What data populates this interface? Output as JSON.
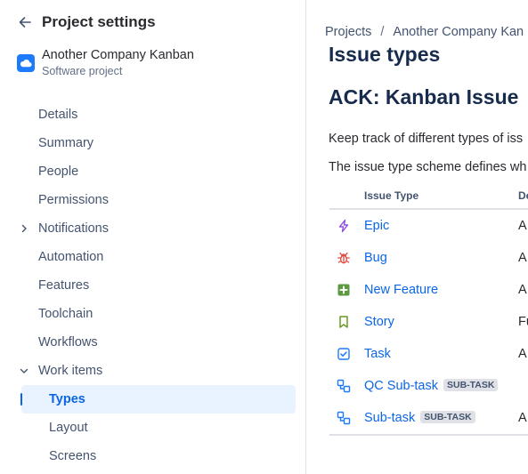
{
  "sidebar": {
    "title": "Project settings",
    "project": {
      "name": "Another Company Kanban",
      "type": "Software project",
      "avatar_color": "#1d7afc"
    },
    "nav": [
      {
        "label": "Details"
      },
      {
        "label": "Summary"
      },
      {
        "label": "People"
      },
      {
        "label": "Permissions"
      },
      {
        "label": "Notifications",
        "chevron": "chevron-right-icon"
      },
      {
        "label": "Automation"
      },
      {
        "label": "Features"
      },
      {
        "label": "Toolchain"
      },
      {
        "label": "Workflows"
      },
      {
        "label": "Work items",
        "chevron": "chevron-down-icon",
        "expanded": true
      },
      {
        "label": "Types",
        "selected": true
      },
      {
        "label": "Layout"
      },
      {
        "label": "Screens"
      }
    ]
  },
  "main": {
    "breadcrumb": [
      "Projects",
      "Another Company Kan"
    ],
    "breadcrumb_sep": "/",
    "title": "Issue types",
    "scheme_title": "ACK: Kanban Issue",
    "desc1": "Keep track of different types of iss",
    "desc2": "The issue type scheme defines wh",
    "table": {
      "headers": [
        "Issue Type",
        "De"
      ],
      "rows": [
        {
          "name": "Epic",
          "icon": "epic-lightning-icon",
          "color": "#904ee2",
          "desc": "A"
        },
        {
          "name": "Bug",
          "icon": "bug-icon",
          "color": "#e2483d",
          "desc": "A"
        },
        {
          "name": "New Feature",
          "icon": "new-feature-plus-icon",
          "color": "#5b9a3f",
          "desc": "A"
        },
        {
          "name": "Story",
          "icon": "story-bookmark-icon",
          "color": "#6a9a23",
          "desc": "Fu"
        },
        {
          "name": "Task",
          "icon": "task-checkbox-icon",
          "color": "#1d7afc",
          "desc": "A"
        },
        {
          "name": "QC Sub-task",
          "icon": "subtask-icon",
          "color": "#1d7afc",
          "badge": "SUB-TASK",
          "desc": ""
        },
        {
          "name": "Sub-task",
          "icon": "subtask-icon",
          "color": "#1d7afc",
          "badge": "SUB-TASK",
          "desc": "A"
        }
      ]
    }
  }
}
